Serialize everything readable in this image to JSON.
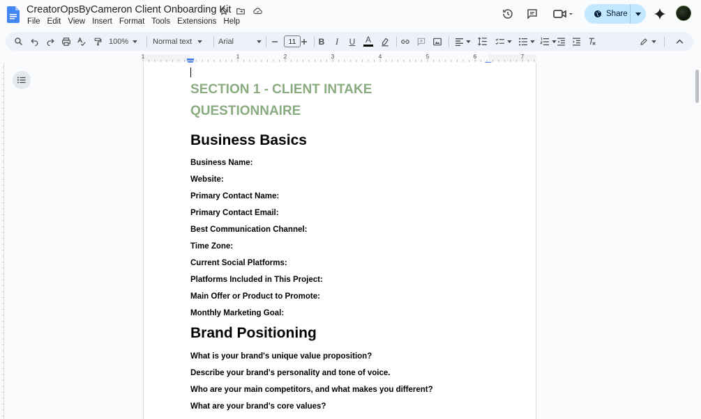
{
  "document": {
    "title": "CreatorOpsByCameron Client Onboarding Kit"
  },
  "menu": [
    "File",
    "Edit",
    "View",
    "Insert",
    "Format",
    "Tools",
    "Extensions",
    "Help"
  ],
  "share": {
    "label": "Share"
  },
  "toolbar": {
    "zoom": "100%",
    "style": "Normal text",
    "font": "Arial",
    "font_size": "11"
  },
  "ruler": {
    "numbers": [
      "1",
      "1",
      "2",
      "3",
      "4",
      "5",
      "6",
      "7"
    ]
  },
  "content": {
    "section_title_line1": "SECTION 1 - CLIENT INTAKE",
    "section_title_line2": "QUESTIONNAIRE",
    "heading_business": "Business Basics",
    "business_fields": [
      "Business Name:",
      "Website:",
      "Primary Contact Name:",
      "Primary Contact Email:",
      "Best Communication Channel:",
      "Time Zone:",
      "Current Social Platforms:",
      "Platforms Included in This Project:",
      "Main Offer or Product to Promote:",
      "Monthly Marketing Goal:"
    ],
    "heading_brand": "Brand Positioning",
    "brand_questions": [
      "What is your brand's unique value proposition?",
      "Describe your brand's personality and tone of voice.",
      "Who are your main competitors, and what makes you different?",
      "What are your brand's core values?"
    ]
  },
  "colors": {
    "section_title": "#8aab80",
    "share_bg": "#c2e7ff",
    "toolbar_bg": "#edf2fa",
    "doc_icon": "#4285f4"
  }
}
